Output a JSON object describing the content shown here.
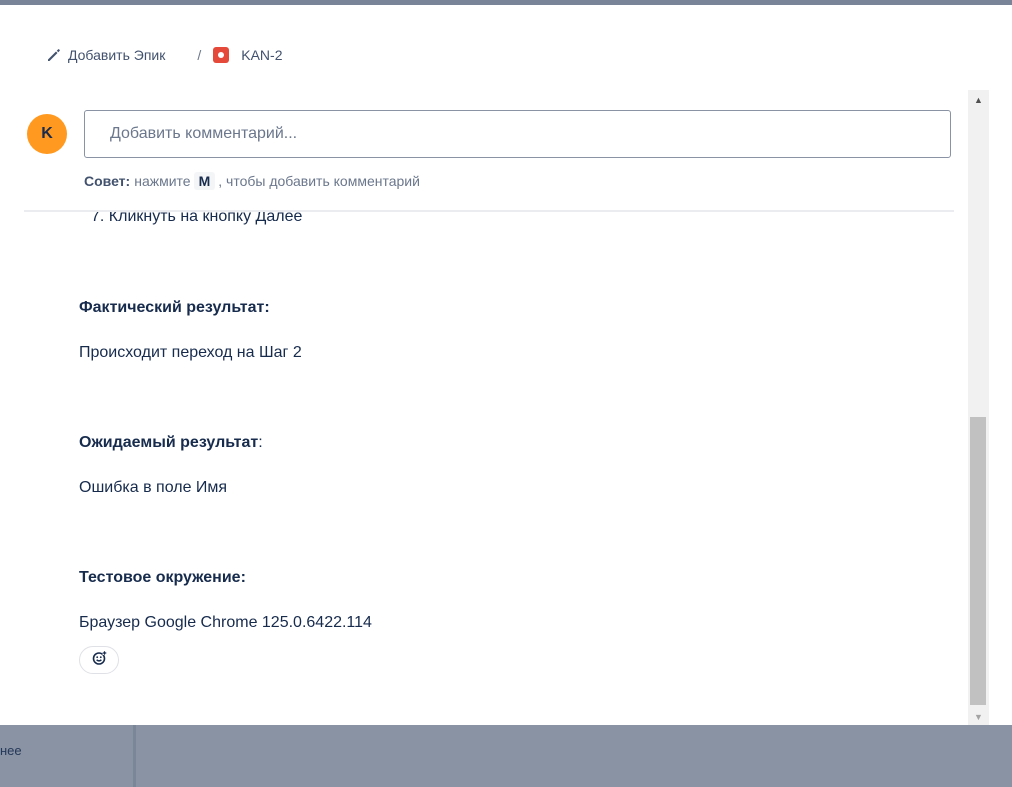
{
  "breadcrumb": {
    "add_epic": "Добавить Эпик",
    "separator": "/",
    "issue_key": "KAN-2"
  },
  "comment": {
    "avatar_initial": "K",
    "placeholder": "Добавить комментарий...",
    "tip_label": "Совет:",
    "tip_before": "нажмите",
    "tip_key": "M",
    "tip_after": ", чтобы добавить комментарий"
  },
  "description": {
    "step": "7. Кликнуть на кнопку Далее",
    "actual_heading": "Фактический результат:",
    "actual_text": "Происходит переход на Шаг 2",
    "expected_heading": "Ожидаемый результат",
    "expected_colon": ":",
    "expected_text": "Ошибка в поле Имя",
    "env_heading": "Тестовое окружение:",
    "env_text": "Браузер Google Chrome 125.0.6422.114"
  },
  "background": {
    "partial_text": "нее"
  },
  "icons": {
    "edit": "pencil-icon",
    "issue_type": "bug-icon",
    "reaction": "emoji-add-icon"
  },
  "colors": {
    "avatar": "#ff991f",
    "bug": "#e5493a",
    "text": "#172b4d",
    "overlay": "#8993a4"
  }
}
